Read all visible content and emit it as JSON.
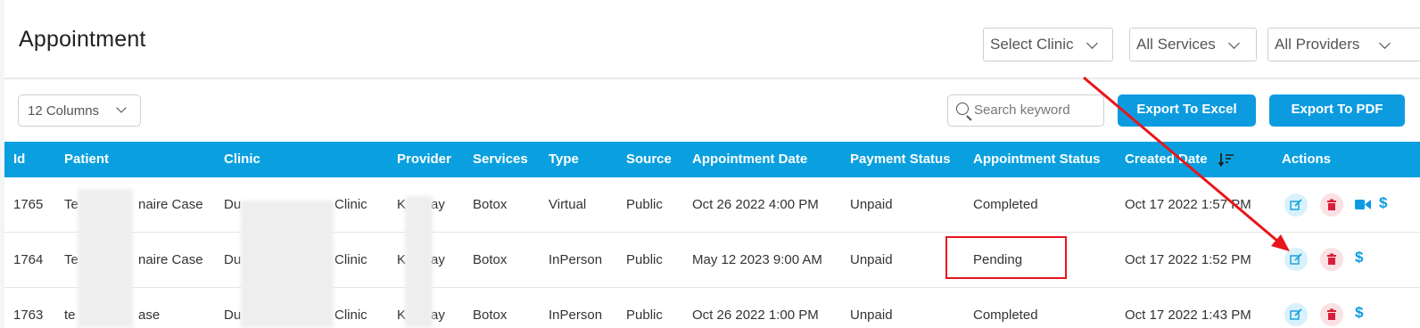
{
  "page": {
    "title": "Appointment"
  },
  "filters": {
    "clinic": "Select Clinic",
    "services": "All Services",
    "providers": "All Providers"
  },
  "toolbar": {
    "columns": "12 Columns",
    "search_placeholder": "Search keyword",
    "export_excel": "Export To Excel",
    "export_pdf": "Export To PDF"
  },
  "table": {
    "headers": [
      "Id",
      "Patient",
      "Clinic",
      "Provider",
      "Services",
      "Type",
      "Source",
      "Appointment Date",
      "Payment Status",
      "Appointment Status",
      "Created Date",
      "Actions"
    ],
    "rows": [
      {
        "id": "1765",
        "patient_a": "Te",
        "patient_b": "naire Case",
        "clinic_a": "Du",
        "clinic_b": "Clinic",
        "provider_a": "K",
        "provider_b": "ay",
        "services": "Botox",
        "type": "Virtual",
        "source": "Public",
        "appointment_date": "Oct 26 2022 4:00 PM",
        "payment_status": "Unpaid",
        "appointment_status": "Completed",
        "created_date": "Oct 17 2022 1:57 PM"
      },
      {
        "id": "1764",
        "patient_a": "Te",
        "patient_b": "naire Case",
        "clinic_a": "Du",
        "clinic_b": "Clinic",
        "provider_a": "K",
        "provider_b": "ay",
        "services": "Botox",
        "type": "InPerson",
        "source": "Public",
        "appointment_date": "May 12 2023 9:00 AM",
        "payment_status": "Unpaid",
        "appointment_status": "Pending",
        "created_date": "Oct 17 2022 1:52 PM"
      },
      {
        "id": "1763",
        "patient_a": "te",
        "patient_b": "ase",
        "clinic_a": "Du",
        "clinic_b": "Clinic",
        "provider_a": "K",
        "provider_b": "ay",
        "services": "Botox",
        "type": "InPerson",
        "source": "Public",
        "appointment_date": "Oct 26 2022 1:00 PM",
        "payment_status": "Unpaid",
        "appointment_status": "Completed",
        "created_date": "Oct 17 2022 1:43 PM"
      }
    ],
    "action_icons": [
      "edit-icon",
      "trash-icon",
      "video-icon",
      "dollar-icon"
    ],
    "dollar_symbol": "$"
  },
  "colors": {
    "header_bg": "#0aa0df",
    "button_bg": "#0d9be0",
    "annotation": "#e8151b",
    "edit_bg": "#d9f1fb",
    "delete_bg": "#fbe1e4"
  }
}
